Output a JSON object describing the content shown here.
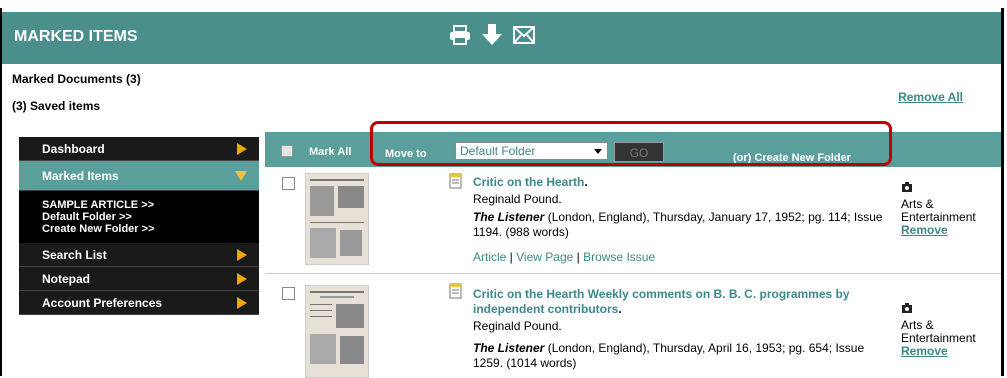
{
  "header": {
    "title": "MARKED ITEMS",
    "icons": [
      "printer-icon",
      "download-icon",
      "email-icon"
    ]
  },
  "summary": {
    "documents": "Marked Documents (3)",
    "saved": "(3) Saved items",
    "remove_all": "Remove All"
  },
  "sidebar": {
    "dashboard": "Dashboard",
    "marked_items": "Marked Items",
    "sub": [
      "SAMPLE ARTICLE >>",
      "Default Folder >>",
      "Create New Folder >>"
    ],
    "search_list": "Search List",
    "notepad": "Notepad",
    "account_preferences": "Account Preferences"
  },
  "toolbar": {
    "mark_all": "Mark All",
    "move_to": "Move to",
    "folder": "Default Folder",
    "go": "GO",
    "create": "(or) Create New Folder"
  },
  "results": [
    {
      "title": "Critic on the Hearth",
      "author": "Reginald Pound.",
      "publication": "The Listener",
      "source_rest": " (London, England),  Thursday,  January 17, 1952; pg. 114; Issue 1194.  (988 words)",
      "links": [
        "Article",
        "View Page",
        "Browse Issue"
      ],
      "category": "Arts & Entertainment",
      "remove": "Remove"
    },
    {
      "title": "Critic on the Hearth Weekly comments on B. B. C. programmes by independent contributors",
      "author": "Reginald Pound.",
      "publication": "The Listener",
      "source_rest": " (London, England),  Thursday,  April 16, 1953; pg. 654; Issue 1259.  (1014 words)",
      "category": "Arts & Entertainment",
      "remove": "Remove"
    }
  ],
  "colors": {
    "teal": "#4a8f8c",
    "teal_light": "#5a9f9c",
    "highlight": "#c00000",
    "arrow": "#f0a800"
  }
}
